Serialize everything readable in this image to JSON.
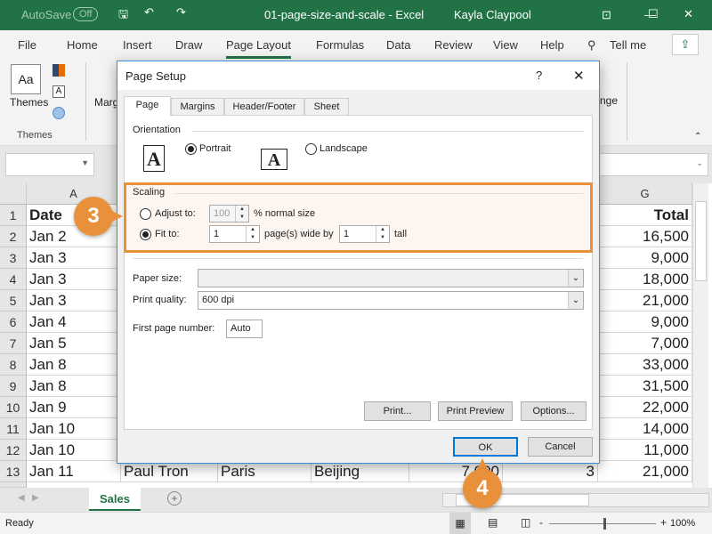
{
  "titlebar": {
    "autosave": "AutoSave",
    "autosave_state": "Off",
    "doc_title": "01-page-size-and-scale  -  Excel",
    "user": "Kayla Claypool"
  },
  "menu": {
    "items": [
      "File",
      "Home",
      "Insert",
      "Draw",
      "Page Layout",
      "Formulas",
      "Data",
      "Review",
      "View",
      "Help"
    ],
    "active": "Page Layout",
    "tell_me": "Tell me"
  },
  "ribbon": {
    "themes_label": "Themes",
    "group_label": "Themes",
    "margins_partial": "Marg",
    "arrange_partial": "nge"
  },
  "sheet": {
    "columns": [
      "A",
      "G"
    ],
    "rows": [
      {
        "n": "1",
        "a": "Date",
        "g": "Total"
      },
      {
        "n": "2",
        "a": "Jan 2",
        "g": "16,500"
      },
      {
        "n": "3",
        "a": "Jan 3",
        "g": "9,000"
      },
      {
        "n": "4",
        "a": "Jan 3",
        "g": "18,000"
      },
      {
        "n": "5",
        "a": "Jan 3",
        "g": "21,000"
      },
      {
        "n": "6",
        "a": "Jan 4",
        "g": "9,000"
      },
      {
        "n": "7",
        "a": "Jan 5",
        "g": "7,000"
      },
      {
        "n": "8",
        "a": "Jan 8",
        "g": "33,000"
      },
      {
        "n": "9",
        "a": "Jan 8",
        "g": "31,500"
      },
      {
        "n": "10",
        "a": "Jan 9",
        "g": "22,000"
      },
      {
        "n": "11",
        "a": "Jan 10",
        "g": "14,000"
      },
      {
        "n": "12",
        "a": "Jan 10",
        "g": "11,000"
      },
      {
        "n": "13",
        "a": "Jan 11",
        "g": "21,000"
      }
    ],
    "row13": {
      "b": "Paul Tron",
      "c": "Paris",
      "d": "Beijing",
      "e": "7,000",
      "f": "3"
    },
    "tab": "Sales"
  },
  "status": {
    "ready": "Ready",
    "zoom": "100%"
  },
  "dialog": {
    "title": "Page Setup",
    "help": "?",
    "tabs": [
      "Page",
      "Margins",
      "Header/Footer",
      "Sheet"
    ],
    "orientation": {
      "legend": "Orientation",
      "portrait": "Portrait",
      "landscape": "Landscape",
      "selected": "Portrait"
    },
    "scaling": {
      "legend": "Scaling",
      "adjust_label": "Adjust to:",
      "adjust_value": "100",
      "adjust_suffix": "% normal size",
      "fit_label": "Fit to:",
      "fit_wide": "1",
      "wide_suffix": "page(s) wide by",
      "fit_tall": "1",
      "tall_suffix": "tall",
      "selected": "Fit to"
    },
    "paper_size_label": "Paper size:",
    "paper_size_value": "",
    "print_quality_label": "Print quality:",
    "print_quality_value": "600 dpi",
    "first_page_label": "First page number:",
    "first_page_value": "Auto",
    "buttons": {
      "print": "Print...",
      "preview": "Print Preview",
      "options": "Options...",
      "ok": "OK",
      "cancel": "Cancel"
    }
  },
  "callouts": [
    "3",
    "4"
  ],
  "colors": {
    "excel_green": "#217346",
    "callout": "#e8913a",
    "dialog_border": "#3b8dd6"
  }
}
